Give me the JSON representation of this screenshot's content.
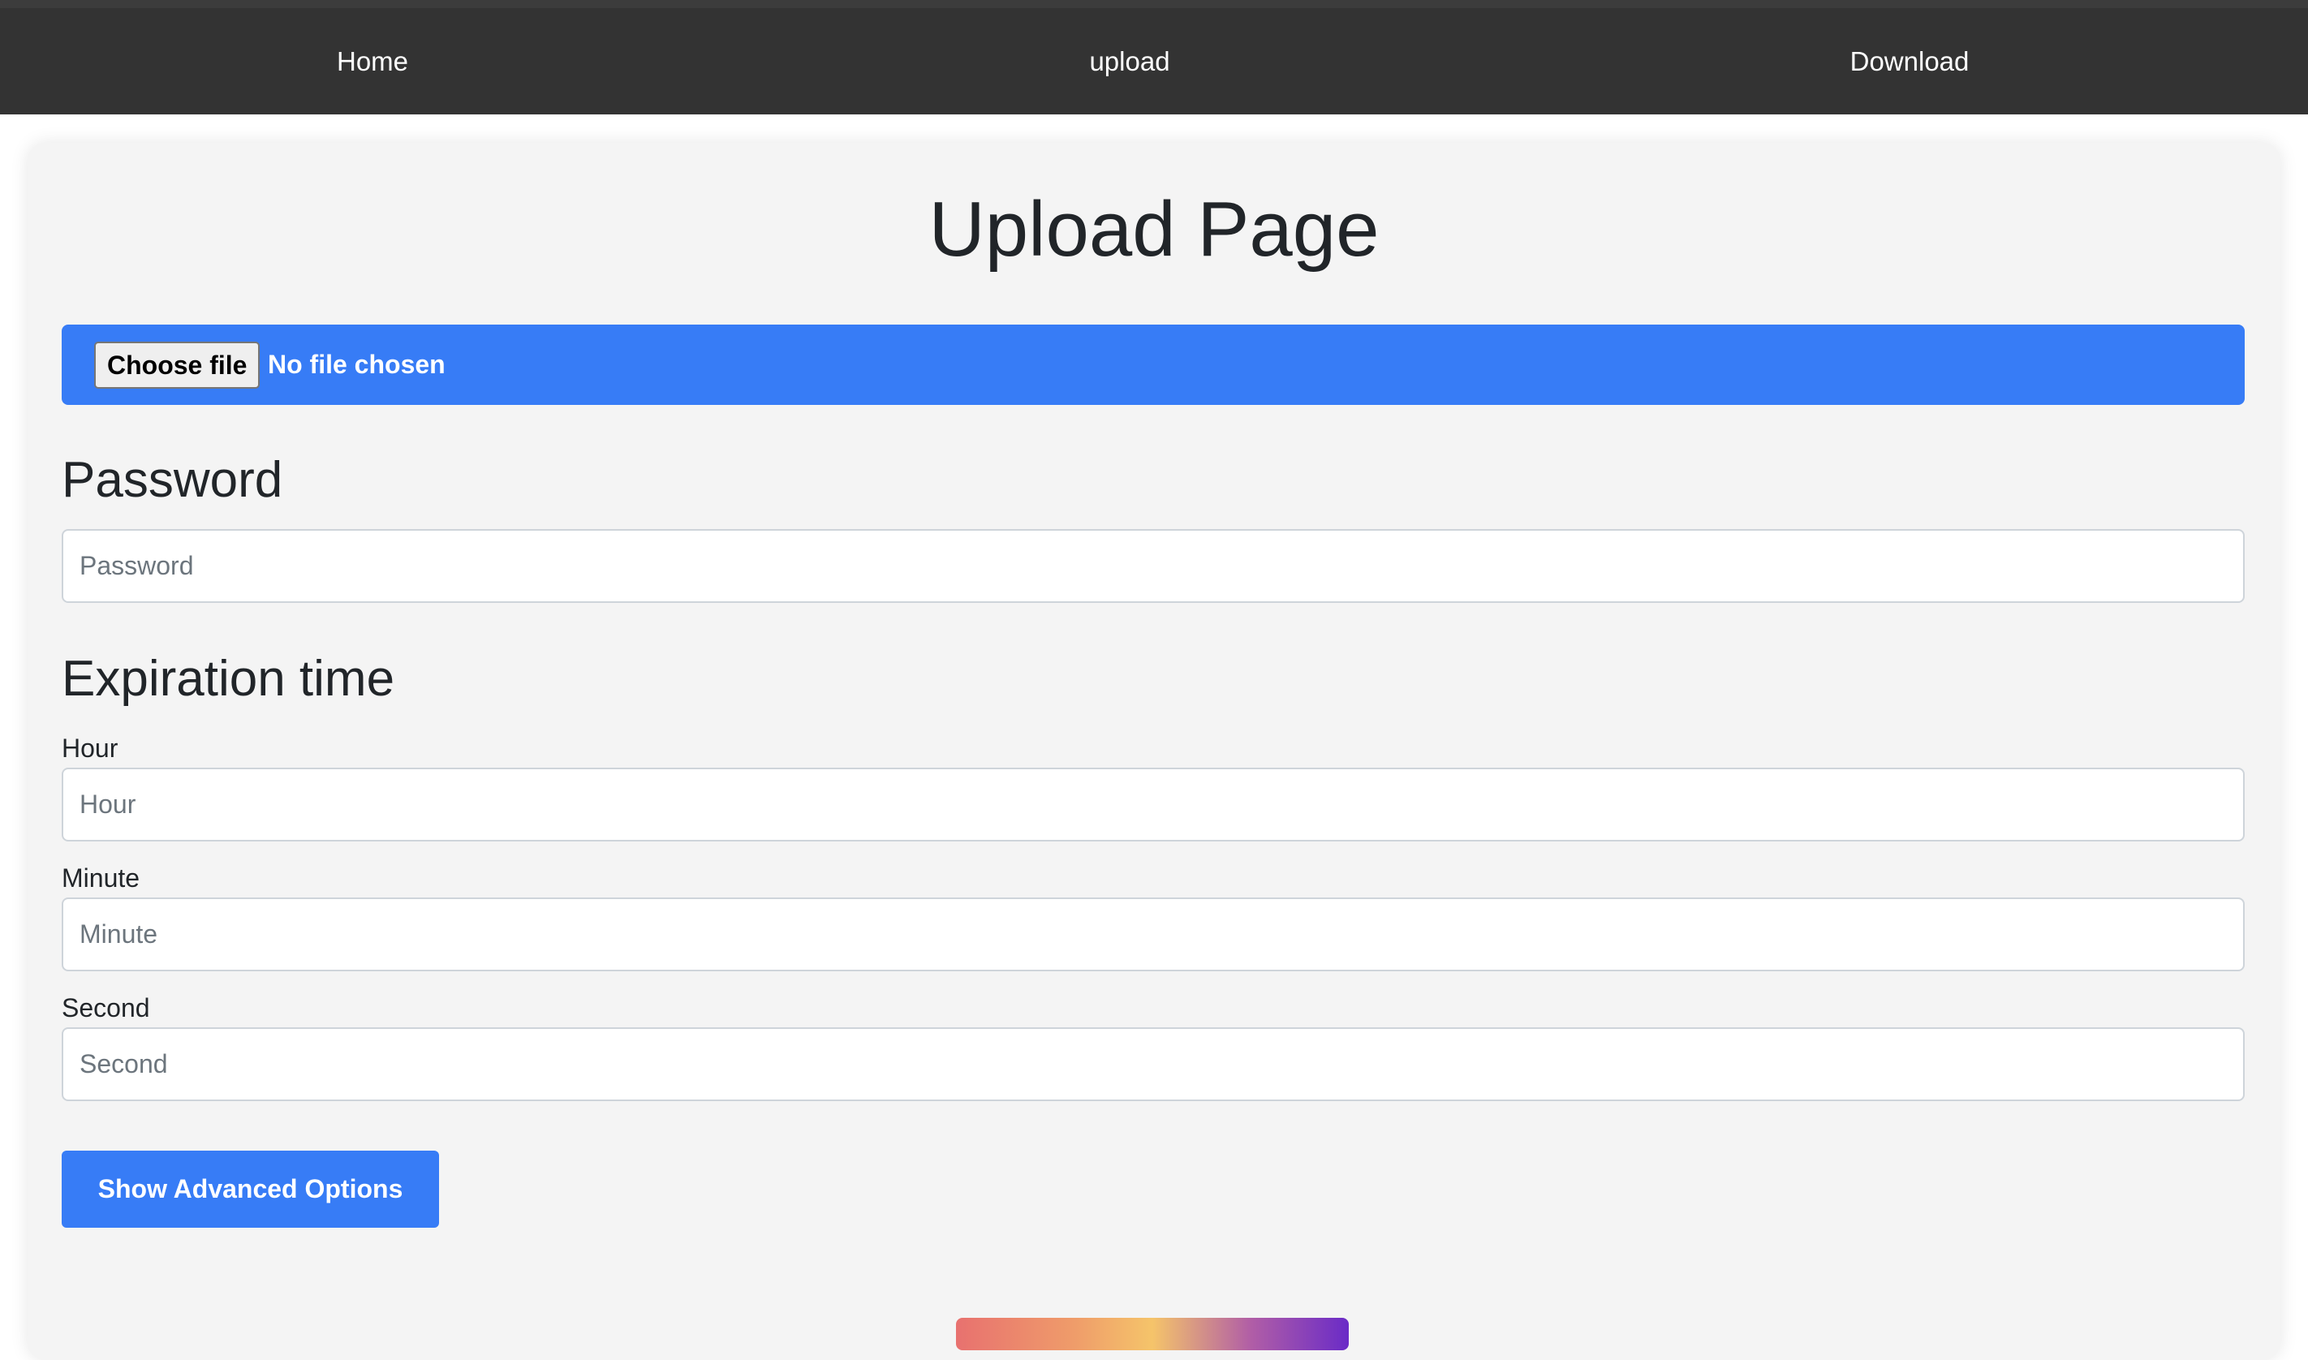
{
  "nav": {
    "home": "Home",
    "upload": "upload",
    "download": "Download"
  },
  "page": {
    "title": "Upload Page"
  },
  "file_input": {
    "button_label": "Choose file",
    "status": "No file chosen"
  },
  "password": {
    "heading": "Password",
    "placeholder": "Password",
    "value": ""
  },
  "expiration": {
    "heading": "Expiration time",
    "hour_label": "Hour",
    "hour_placeholder": "Hour",
    "minute_label": "Minute",
    "minute_placeholder": "Minute",
    "second_label": "Second",
    "second_placeholder": "Second"
  },
  "advanced": {
    "button_label": "Show Advanced Options"
  },
  "colors": {
    "navbar_bg": "#333333",
    "accent_blue": "#377cf6",
    "card_bg": "#f4f4f4"
  }
}
